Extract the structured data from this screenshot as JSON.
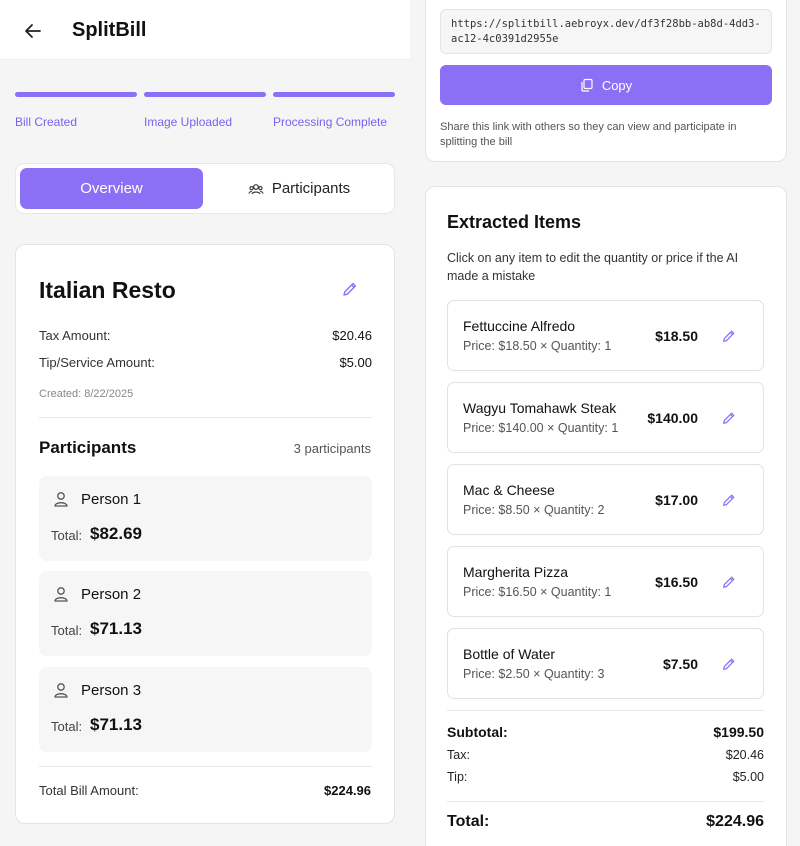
{
  "app": {
    "title": "SplitBill"
  },
  "steps": [
    "Bill Created",
    "Image Uploaded",
    "Processing Complete"
  ],
  "tabs": {
    "overview": "Overview",
    "participants": "Participants"
  },
  "bill": {
    "name": "Italian Resto",
    "tax_label": "Tax Amount:",
    "tax_value": "$20.46",
    "tip_label": "Tip/Service Amount:",
    "tip_value": "$5.00",
    "created": "Created: 8/22/2025"
  },
  "participants": {
    "heading": "Participants",
    "count": "3 participants",
    "total_label": "Total:",
    "people": [
      {
        "name": "Person 1",
        "total": "$82.69"
      },
      {
        "name": "Person 2",
        "total": "$71.13"
      },
      {
        "name": "Person 3",
        "total": "$71.13"
      }
    ],
    "bill_total_label": "Total Bill Amount:",
    "bill_total_value": "$224.96"
  },
  "share": {
    "url": "https://splitbill.aebroyx.dev/df3f28bb-ab8d-4dd3-ac12-4c0391d2955e",
    "copy_label": "Copy",
    "note": "Share this link with others so they can view and participate in splitting the bill"
  },
  "items_section": {
    "title": "Extracted Items",
    "description": "Click on any item to edit the quantity or price if the AI made a mistake",
    "items": [
      {
        "name": "Fettuccine Alfredo",
        "detail": "Price: $18.50 × Quantity: 1",
        "price": "$18.50"
      },
      {
        "name": "Wagyu Tomahawk Steak",
        "detail": "Price: $140.00 × Quantity: 1",
        "price": "$140.00"
      },
      {
        "name": "Mac & Cheese",
        "detail": "Price: $8.50 × Quantity: 2",
        "price": "$17.00"
      },
      {
        "name": "Margherita Pizza",
        "detail": "Price: $16.50 × Quantity: 1",
        "price": "$16.50"
      },
      {
        "name": "Bottle of Water",
        "detail": "Price: $2.50 × Quantity: 3",
        "price": "$7.50"
      }
    ],
    "subtotal_label": "Subtotal:",
    "subtotal_value": "$199.50",
    "tax_label": "Tax:",
    "tax_value": "$20.46",
    "tip_label": "Tip:",
    "tip_value": "$5.00",
    "total_label": "Total:",
    "total_value": "$224.96"
  },
  "colors": {
    "accent": "#8b6ff5",
    "accent_text": "#7c5ff0"
  },
  "icons": [
    "back-arrow-icon",
    "users-icon",
    "pencil-icon",
    "user-icon",
    "copy-icon"
  ]
}
